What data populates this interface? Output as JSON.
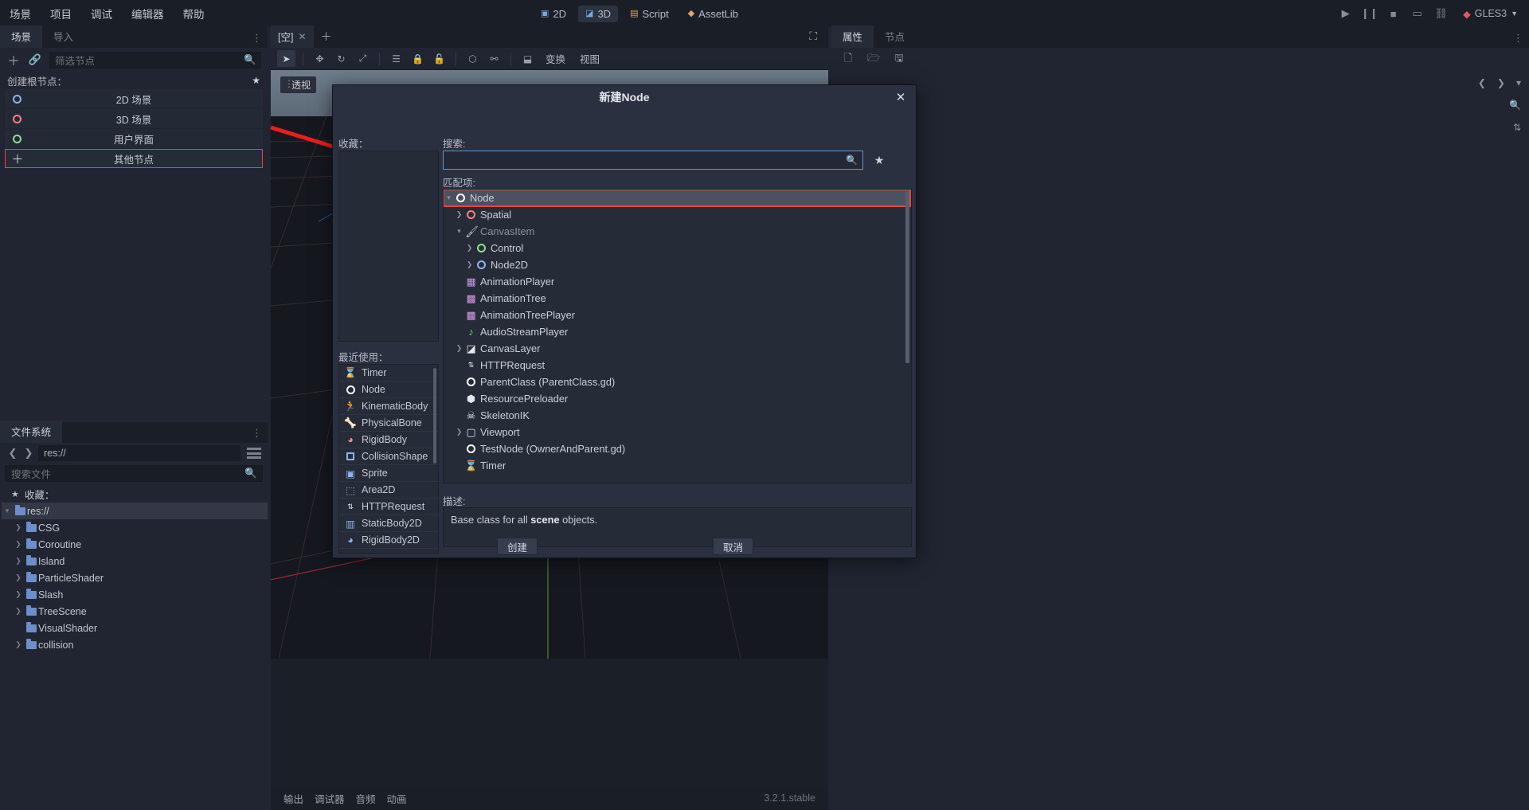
{
  "menubar": {
    "items": [
      "场景",
      "项目",
      "调试",
      "编辑器",
      "帮助"
    ],
    "modes": [
      {
        "label": "2D",
        "icon": "2d-icon"
      },
      {
        "label": "3D",
        "icon": "3d-icon"
      },
      {
        "label": "Script",
        "icon": "script-icon"
      },
      {
        "label": "AssetLib",
        "icon": "assetlib-icon"
      }
    ],
    "right_tools": [
      "play-icon",
      "pause-icon",
      "stop-icon",
      "movie-icon",
      "link-icon"
    ],
    "renderer": "GLES3"
  },
  "scene_panel": {
    "tabs": [
      {
        "label": "场景",
        "active": true
      },
      {
        "label": "导入",
        "active": false
      }
    ],
    "toolbar": {
      "add_icon": "plus-icon",
      "link_icon": "link-icon",
      "search_icon": "search-icon"
    },
    "filter_placeholder": "筛选节点",
    "create_root_label": "创建根节点：",
    "root_options": [
      {
        "label": "2D 场景",
        "icon": "circle-blue-icon"
      },
      {
        "label": "3D 场景",
        "icon": "circle-red-icon"
      },
      {
        "label": "用户界面",
        "icon": "circle-green-icon"
      },
      {
        "label": "其他节点",
        "icon": "plus-icon",
        "selected": true
      }
    ]
  },
  "filesystem": {
    "tab_label": "文件系统",
    "path": "res://",
    "search_placeholder": "搜索文件",
    "favorites_label": "收藏：",
    "tree": [
      {
        "label": "res://",
        "depth": 0,
        "expanded": true,
        "selected": true
      },
      {
        "label": "CSG",
        "depth": 1,
        "expanded": false
      },
      {
        "label": "Coroutine",
        "depth": 1,
        "expanded": false
      },
      {
        "label": "Island",
        "depth": 1,
        "expanded": false
      },
      {
        "label": "ParticleShader",
        "depth": 1,
        "expanded": false
      },
      {
        "label": "Slash",
        "depth": 1,
        "expanded": false
      },
      {
        "label": "TreeScene",
        "depth": 1,
        "expanded": false
      },
      {
        "label": "VisualShader",
        "depth": 1,
        "expanded": false
      },
      {
        "label": "collision",
        "depth": 1,
        "expanded": false
      }
    ]
  },
  "viewport": {
    "tab_label": "[空]",
    "toolbar_icons": [
      "select-icon",
      "move-icon",
      "rotate-icon",
      "scale-icon",
      "list-icon",
      "lock-icon",
      "unlock-icon",
      "group-icon",
      "ungroup-icon",
      "snap-icon"
    ],
    "menus": [
      "变换",
      "视图"
    ],
    "perspective_label": "透视",
    "maximize_icon": "maximize-icon",
    "bottom_tabs": [
      "输出",
      "调试器",
      "音频",
      "动画"
    ],
    "version": "3.2.1.stable"
  },
  "inspector": {
    "tabs": [
      {
        "label": "属性",
        "active": true
      },
      {
        "label": "节点",
        "active": false
      }
    ],
    "tools": [
      "new-resource-icon",
      "open-folder-icon",
      "save-icon"
    ],
    "nav": [
      "chevron-left-icon",
      "chevron-right-icon",
      "history-icon"
    ],
    "right_tools": [
      "object-icon",
      "search-icon",
      "sort-icon"
    ]
  },
  "dialog": {
    "title": "新建Node",
    "close_icon": "close-icon",
    "favorites_label": "收藏：",
    "recent_label": "最近使用：",
    "search_label": "搜索:",
    "search_value": "",
    "search_icon": "search-icon",
    "favorite_star_icon": "star-icon",
    "matches_label": "匹配项:",
    "description_label": "描述:",
    "description_prefix": "Base class for all ",
    "description_bold": "scene",
    "description_suffix": " objects.",
    "create_button": "创建",
    "cancel_button": "取消",
    "recent_items": [
      {
        "label": "Timer",
        "icon": "timer-icon"
      },
      {
        "label": "Node",
        "icon": "circle-white-icon"
      },
      {
        "label": "KinematicBody",
        "icon": "kinematic-body-icon"
      },
      {
        "label": "PhysicalBone",
        "icon": "bone-icon"
      },
      {
        "label": "RigidBody",
        "icon": "rigid-body-icon"
      },
      {
        "label": "CollisionShape",
        "icon": "square-blue-icon"
      },
      {
        "label": "Sprite",
        "icon": "sprite-icon"
      },
      {
        "label": "Area2D",
        "icon": "area2d-icon"
      },
      {
        "label": "HTTPRequest",
        "icon": "http-icon"
      },
      {
        "label": "StaticBody2D",
        "icon": "staticbody2d-icon"
      },
      {
        "label": "RigidBody2D",
        "icon": "rigidbody2d-icon"
      }
    ],
    "matches": [
      {
        "label": "Node",
        "depth": 0,
        "icon": "circle-white-icon",
        "twisty": "down",
        "selected": true
      },
      {
        "label": "Spatial",
        "depth": 1,
        "icon": "circle-red-icon",
        "twisty": "right"
      },
      {
        "label": "CanvasItem",
        "depth": 1,
        "icon": "brush-icon",
        "twisty": "down",
        "dim": true
      },
      {
        "label": "Control",
        "depth": 2,
        "icon": "circle-green-icon",
        "twisty": "right"
      },
      {
        "label": "Node2D",
        "depth": 2,
        "icon": "circle-blue-icon",
        "twisty": "right"
      },
      {
        "label": "AnimationPlayer",
        "depth": 1,
        "icon": "animation-player-icon",
        "twisty": ""
      },
      {
        "label": "AnimationTree",
        "depth": 1,
        "icon": "animation-tree-icon",
        "twisty": ""
      },
      {
        "label": "AnimationTreePlayer",
        "depth": 1,
        "icon": "animation-tree-icon",
        "twisty": ""
      },
      {
        "label": "AudioStreamPlayer",
        "depth": 1,
        "icon": "audio-stream-icon",
        "twisty": ""
      },
      {
        "label": "CanvasLayer",
        "depth": 1,
        "icon": "canvas-layer-icon",
        "twisty": "right"
      },
      {
        "label": "HTTPRequest",
        "depth": 1,
        "icon": "http-icon",
        "twisty": ""
      },
      {
        "label": "ParentClass (ParentClass.gd)",
        "depth": 1,
        "icon": "circle-white-icon",
        "twisty": ""
      },
      {
        "label": "ResourcePreloader",
        "depth": 1,
        "icon": "resource-preloader-icon",
        "twisty": ""
      },
      {
        "label": "SkeletonIK",
        "depth": 1,
        "icon": "skeleton-ik-icon",
        "twisty": ""
      },
      {
        "label": "Viewport",
        "depth": 1,
        "icon": "viewport-icon",
        "twisty": "right"
      },
      {
        "label": "TestNode (OwnerAndParent.gd)",
        "depth": 1,
        "icon": "circle-white-icon",
        "twisty": ""
      },
      {
        "label": "Timer",
        "depth": 1,
        "icon": "timer-icon",
        "twisty": ""
      }
    ]
  },
  "colors": {
    "accent": "#5b9bd5",
    "highlight_red": "#e8453c",
    "panel_bg": "#202531",
    "dialog_bg": "#2a3040",
    "list_bg": "#262b38"
  }
}
